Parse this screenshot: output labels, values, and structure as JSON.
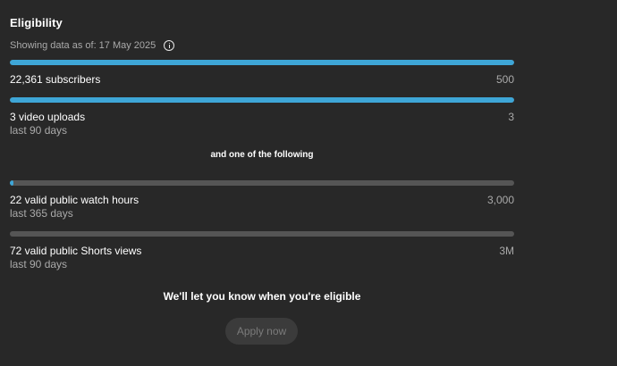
{
  "title": "Eligibility",
  "data_as_of": "Showing data as of: 17 May 2025",
  "info_icon": "info-circle-icon",
  "colors": {
    "background": "#282828",
    "progress_fill": "#3ea6d7",
    "progress_track": "#555555",
    "muted_text": "#aaaaaa"
  },
  "requirements": [
    {
      "label": "22,361 subscribers",
      "target": "500",
      "sublabel": "",
      "progress_percent": 100
    },
    {
      "label": "3 video uploads",
      "target": "3",
      "sublabel": "last 90 days",
      "progress_percent": 100
    }
  ],
  "either_text": "and one of the following",
  "alternatives": [
    {
      "label": "22 valid public watch hours",
      "target": "3,000",
      "sublabel": "last 365 days",
      "progress_percent": 0.7
    },
    {
      "label": "72 valid public Shorts views",
      "target": "3M",
      "sublabel": "last 90 days",
      "progress_percent": 0
    }
  ],
  "notice": "We'll let you know when you're eligible",
  "apply_button": {
    "label": "Apply now",
    "disabled": true
  }
}
